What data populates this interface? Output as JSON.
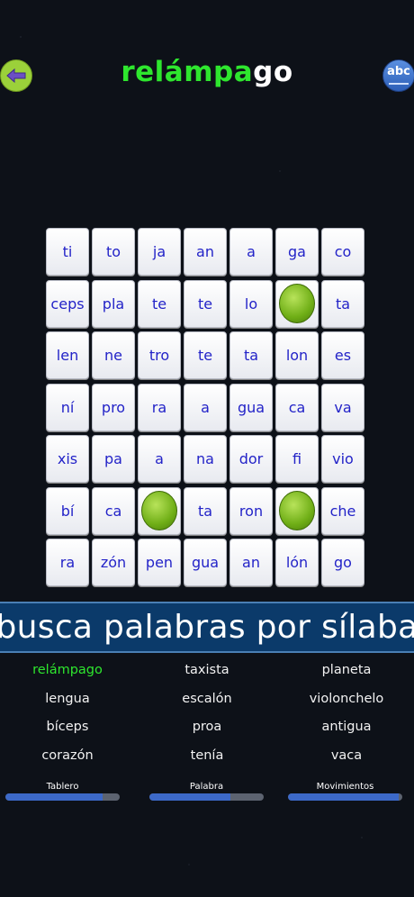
{
  "header": {
    "title_found": "relámpa",
    "title_rest": "go",
    "back_icon": "arrow-left-icon",
    "abc_label": "abc",
    "colors": {
      "found": "#2ee62e",
      "rest": "#ffffff"
    }
  },
  "board": {
    "rows": [
      [
        "ti",
        "to",
        "ja",
        "an",
        "a",
        "ga",
        "co"
      ],
      [
        "ceps",
        "pla",
        "te",
        "te",
        "lo",
        "",
        "ta"
      ],
      [
        "len",
        "ne",
        "tro",
        "te",
        "ta",
        "lon",
        "es"
      ],
      [
        "ní",
        "pro",
        "ra",
        "a",
        "gua",
        "ca",
        "va"
      ],
      [
        "xis",
        "pa",
        "a",
        "na",
        "dor",
        "fi",
        "vio"
      ],
      [
        "bí",
        "ca",
        "",
        "ta",
        "ron",
        "",
        "che"
      ],
      [
        "ra",
        "zón",
        "pen",
        "gua",
        "an",
        "lón",
        "go"
      ]
    ],
    "marbles": [
      [
        1,
        5
      ],
      [
        5,
        2
      ],
      [
        5,
        5
      ]
    ],
    "text_color": "#2323c8"
  },
  "banner": {
    "text": "busca palabras por sílaba"
  },
  "words": {
    "columns": [
      [
        "relámpago",
        "lengua",
        "bíceps",
        "corazón"
      ],
      [
        "taxista",
        "escalón",
        "proa",
        "tenía"
      ],
      [
        "planeta",
        "violonchelo",
        "antigua",
        "vaca"
      ]
    ],
    "found": [
      "relámpago"
    ]
  },
  "meters": [
    {
      "label": "Tablero",
      "progress": 0.85
    },
    {
      "label": "Palabra",
      "progress": 0.71
    },
    {
      "label": "Movimientos",
      "progress": 0.97
    }
  ]
}
